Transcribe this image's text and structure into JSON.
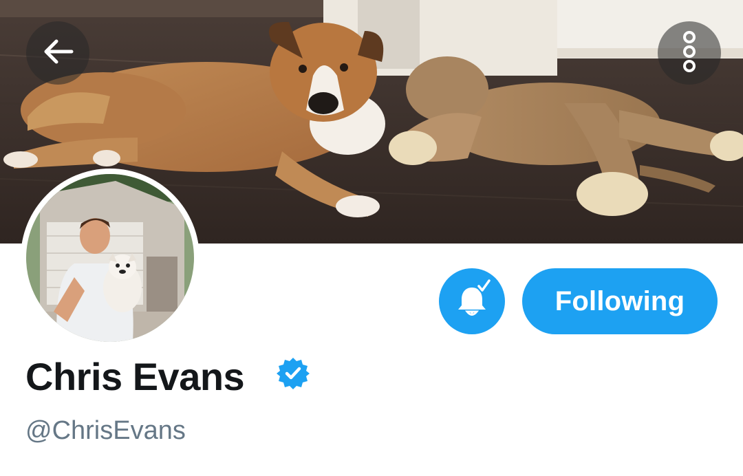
{
  "header": {
    "back_icon": "arrow-left-icon",
    "more_icon": "vertical-dots-icon",
    "banner_description": ""
  },
  "profile": {
    "display_name": "Chris Evans",
    "handle": "@ChrisEvans",
    "verified": true,
    "verified_icon": "verified-badge-icon"
  },
  "actions": {
    "notifications_icon": "bell-check-icon",
    "follow_label": "Following"
  },
  "colors": {
    "accent": "#1da1f2",
    "name_text": "#14171a",
    "handle_text": "#657786"
  }
}
